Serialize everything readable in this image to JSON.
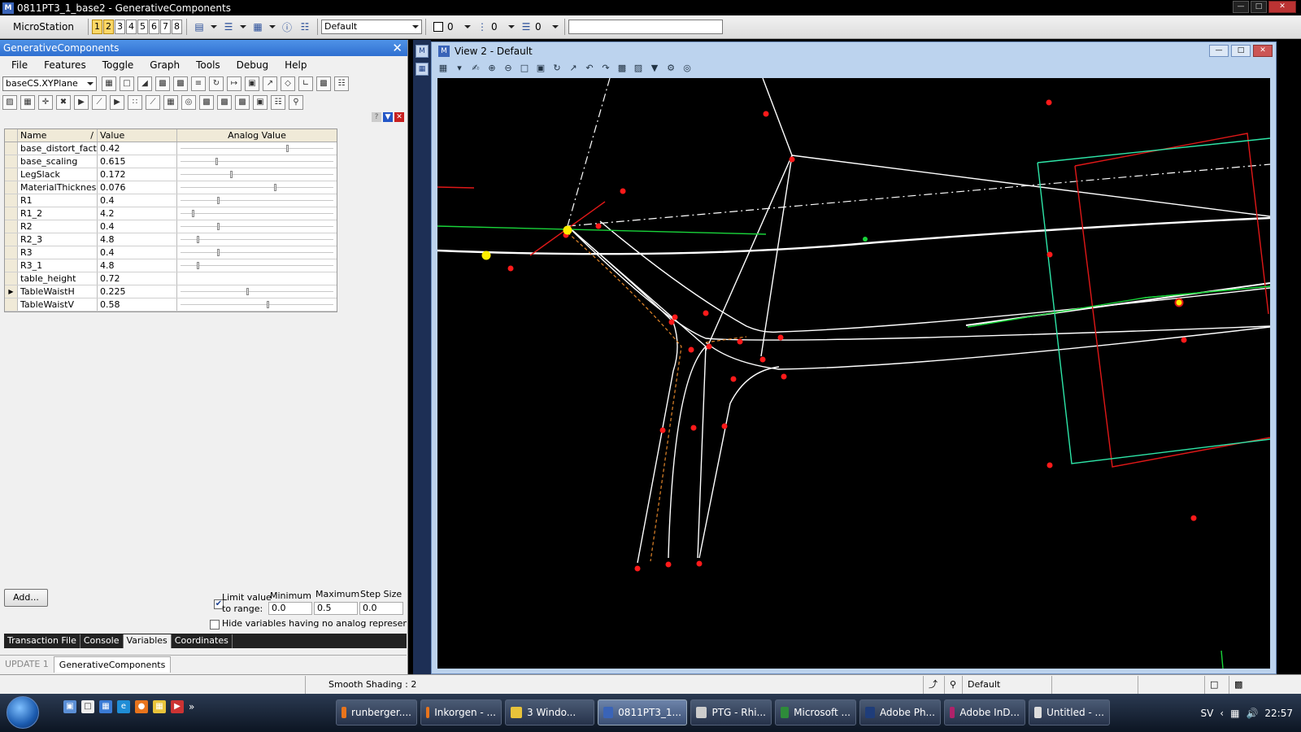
{
  "window": {
    "title": "0811PT3_1_base2 - GenerativeComponents",
    "controls": [
      "minimize-icon",
      "maximize-icon",
      "close-icon"
    ]
  },
  "ms_toolbar": {
    "app_label": "MicroStation",
    "view_numbers": [
      "1",
      "2",
      "3",
      "4",
      "5",
      "6",
      "7",
      "8"
    ],
    "level_combo": "Default",
    "color_value": "0",
    "style_value": "0",
    "weight_value": "0",
    "search_value": ""
  },
  "gc_panel": {
    "title": "GenerativeComponents",
    "menu": [
      "File",
      "Features",
      "Toggle",
      "Graph",
      "Tools",
      "Debug",
      "Help"
    ],
    "cs_combo": "baseCS.XYPlane"
  },
  "variables": {
    "headers": {
      "name": "Name",
      "value": "Value",
      "analog": "Analog Value"
    },
    "sort_marker": "/",
    "rows": [
      {
        "name": "base_distort_fact...",
        "value": "0.42",
        "slider": 0.72,
        "has_slider": true
      },
      {
        "name": "base_scaling",
        "value": "0.615",
        "slider": 0.24,
        "has_slider": true
      },
      {
        "name": "LegSlack",
        "value": "0.172",
        "slider": 0.34,
        "has_slider": true
      },
      {
        "name": "MaterialThickness",
        "value": "0.076",
        "slider": 0.64,
        "has_slider": true
      },
      {
        "name": "R1",
        "value": "0.4",
        "slider": 0.25,
        "has_slider": true
      },
      {
        "name": "R1_2",
        "value": "4.2",
        "slider": 0.08,
        "has_slider": true
      },
      {
        "name": "R2",
        "value": "0.4",
        "slider": 0.25,
        "has_slider": true
      },
      {
        "name": "R2_3",
        "value": "4.8",
        "slider": 0.11,
        "has_slider": true
      },
      {
        "name": "R3",
        "value": "0.4",
        "slider": 0.25,
        "has_slider": true
      },
      {
        "name": "R3_1",
        "value": "4.8",
        "slider": 0.11,
        "has_slider": true
      },
      {
        "name": "table_height",
        "value": "0.72",
        "slider": 0,
        "has_slider": false
      },
      {
        "name": "TableWaistH",
        "value": "0.225",
        "slider": 0.45,
        "has_slider": true,
        "current": true
      },
      {
        "name": "TableWaistV",
        "value": "0.58",
        "slider": 0.59,
        "has_slider": true
      }
    ]
  },
  "controls": {
    "add_button": "Add...",
    "limit_label_1": "Limit value",
    "limit_label_2": "to range:",
    "limit_checked": true,
    "minimum_label": "Minimum",
    "maximum_label": "Maximum",
    "step_label": "Step Size",
    "minimum_value": "0.0",
    "maximum_value": "0.5",
    "step_value": "0.0",
    "hide_label": "Hide variables having no analog representatio",
    "hide_checked": false
  },
  "gc_tabs": [
    {
      "label": "Transaction File",
      "active": false
    },
    {
      "label": "Console",
      "active": false
    },
    {
      "label": "Variables",
      "active": true
    },
    {
      "label": "Coordinates",
      "active": false
    }
  ],
  "update_bar": {
    "update": "UPDATE 1",
    "gc_tab": "GenerativeComponents"
  },
  "view": {
    "title": "View 2 - Default"
  },
  "status": {
    "shading": "Smooth Shading : 2",
    "level": "Default"
  },
  "taskbar": {
    "tasks": [
      {
        "label": "runberger....",
        "icon_color": "#e8741c",
        "active": false
      },
      {
        "label": "Inkorgen - ...",
        "icon_color": "#e8741c",
        "active": false
      },
      {
        "label": "3 Windo...",
        "icon_color": "#e8c33a",
        "active": false
      },
      {
        "label": "0811PT3_1...",
        "icon_color": "#3a64b8",
        "active": true
      },
      {
        "label": "PTG - Rhi...",
        "icon_color": "#cccccc",
        "active": false
      },
      {
        "label": "Microsoft ...",
        "icon_color": "#2e8b3a",
        "active": false
      },
      {
        "label": "Adobe Ph...",
        "icon_color": "#1f3d7a",
        "active": false
      },
      {
        "label": "Adobe InD...",
        "icon_color": "#b0226a",
        "active": false
      },
      {
        "label": "Untitled - ...",
        "icon_color": "#dddddd",
        "active": false
      }
    ],
    "language": "SV",
    "time": "22:57"
  },
  "colors": {
    "point_red": "#ff1a1a",
    "point_yellow": "#ffee00",
    "curve_white": "#ffffff",
    "construct_green": "#19d43a",
    "cyan_frame": "#2ee6a8",
    "red_frame": "#e01818",
    "orange_dash": "#e3862a"
  }
}
